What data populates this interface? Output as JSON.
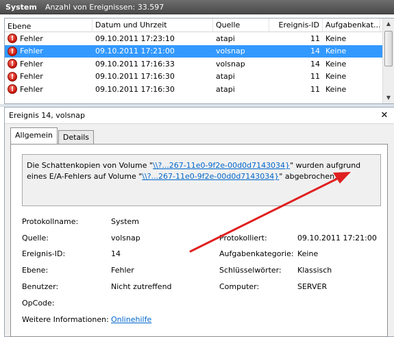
{
  "titlebar": {
    "log_name": "System",
    "event_count": "Anzahl von Ereignissen: 33.597"
  },
  "columns": [
    "Ebene",
    "Datum und Uhrzeit",
    "Quelle",
    "Ereignis-ID",
    "Aufgabenkat..."
  ],
  "rows": [
    {
      "level": "Fehler",
      "date": "09.10.2011 17:23:10",
      "source": "atapi",
      "id": "11",
      "task": "Keine"
    },
    {
      "level": "Fehler",
      "date": "09.10.2011 17:21:00",
      "source": "volsnap",
      "id": "14",
      "task": "Keine"
    },
    {
      "level": "Fehler",
      "date": "09.10.2011 17:16:33",
      "source": "volsnap",
      "id": "14",
      "task": "Keine"
    },
    {
      "level": "Fehler",
      "date": "09.10.2011 17:16:30",
      "source": "atapi",
      "id": "11",
      "task": "Keine"
    },
    {
      "level": "Fehler",
      "date": "09.10.2011 17:16:30",
      "source": "atapi",
      "id": "11",
      "task": "Keine"
    }
  ],
  "selected_row": 1,
  "detail": {
    "title": "Ereignis 14, volsnap",
    "tabs": [
      "Allgemein",
      "Details"
    ],
    "message_part1": "Die Schattenkopien von Volume \"",
    "message_link1": "\\\\?...267-11e0-9f2e-00d0d7143034}",
    "message_part2": "\" wurden aufgrund eines E/A-Fehlers auf Volume \"",
    "message_link2": "\\\\?...267-11e0-9f2e-00d0d7143034}",
    "message_part3": "\" abgebrochen.",
    "props": {
      "protokollname_label": "Protokollname:",
      "protokollname": "System",
      "quelle_label": "Quelle:",
      "quelle": "volsnap",
      "protokolliert_label": "Protokolliert:",
      "protokolliert": "09.10.2011 17:21:00",
      "ereignis_id_label": "Ereignis-ID:",
      "ereignis_id": "14",
      "aufgabenkategorie_label": "Aufgabenkategorie:",
      "aufgabenkategorie": "Keine",
      "ebene_label": "Ebene:",
      "ebene": "Fehler",
      "schluesselwoerter_label": "Schlüsselwörter:",
      "schluesselwoerter": "Klassisch",
      "benutzer_label": "Benutzer:",
      "benutzer": "Nicht zutreffend",
      "computer_label": "Computer:",
      "computer": "SERVER",
      "opcode_label": "OpCode:",
      "weitere_label": "Weitere Informationen:",
      "weitere_link": "Onlinehilfe"
    }
  },
  "colors": {
    "selection": "#3399ff",
    "arrow": "#e02020",
    "link": "#0066cc"
  }
}
